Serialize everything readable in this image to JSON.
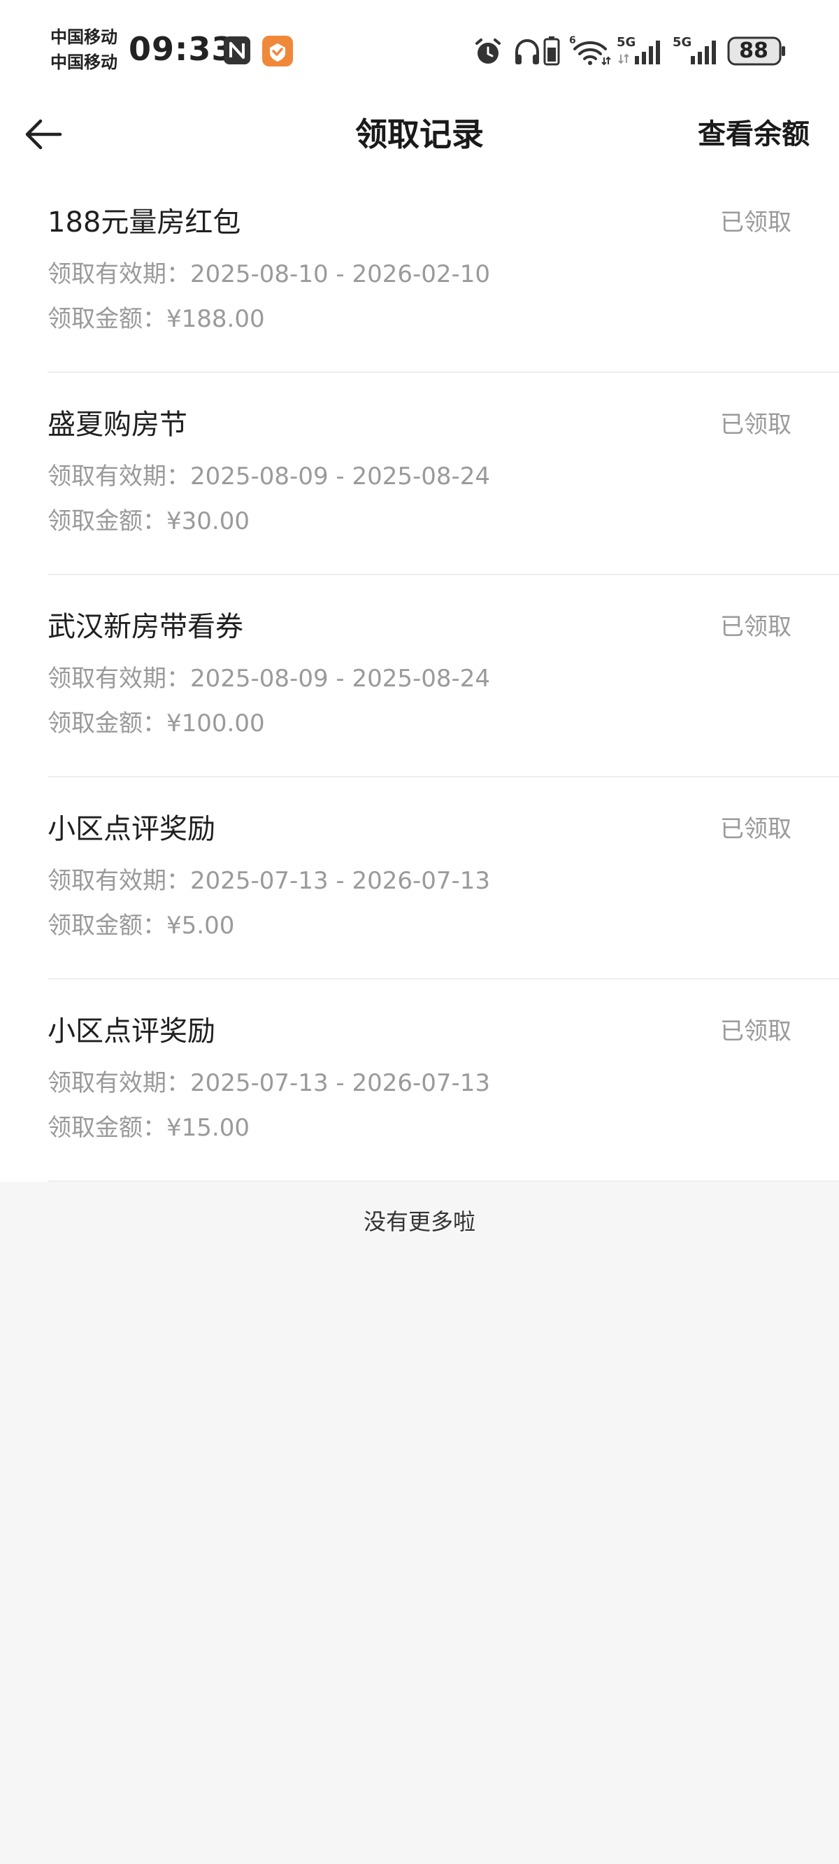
{
  "status_bar": {
    "carrier_1": "中国移动",
    "carrier_2": "中国移动",
    "time": "09:33",
    "battery": "88",
    "icons": [
      "nfc-icon",
      "app-badge-icon",
      "alarm-icon",
      "headphone-icon",
      "battery-saver-icon",
      "wifi-icon",
      "signal-5g-icon",
      "signal-5g-icon",
      "battery-icon"
    ]
  },
  "header": {
    "title": "领取记录",
    "right_action": "查看余额"
  },
  "records": [
    {
      "title": "188元量房红包",
      "status": "已领取",
      "validity": "领取有效期：2025-08-10 - 2026-02-10",
      "amount": "领取金额：¥188.00"
    },
    {
      "title": "盛夏购房节",
      "status": "已领取",
      "validity": "领取有效期：2025-08-09 - 2025-08-24",
      "amount": "领取金额：¥30.00"
    },
    {
      "title": "武汉新房带看券",
      "status": "已领取",
      "validity": "领取有效期：2025-08-09 - 2025-08-24",
      "amount": "领取金额：¥100.00"
    },
    {
      "title": "小区点评奖励",
      "status": "已领取",
      "validity": "领取有效期：2025-07-13 - 2026-07-13",
      "amount": "领取金额：¥5.00"
    },
    {
      "title": "小区点评奖励",
      "status": "已领取",
      "validity": "领取有效期：2025-07-13 - 2026-07-13",
      "amount": "领取金额：¥15.00"
    }
  ],
  "footer": {
    "no_more": "没有更多啦"
  },
  "colors": {
    "page_background": "#f6f6f6",
    "card_background": "#ffffff",
    "title_text": "#1f1f1f",
    "secondary_text": "#9a9a9a",
    "badge_orange": "#f0883a"
  }
}
